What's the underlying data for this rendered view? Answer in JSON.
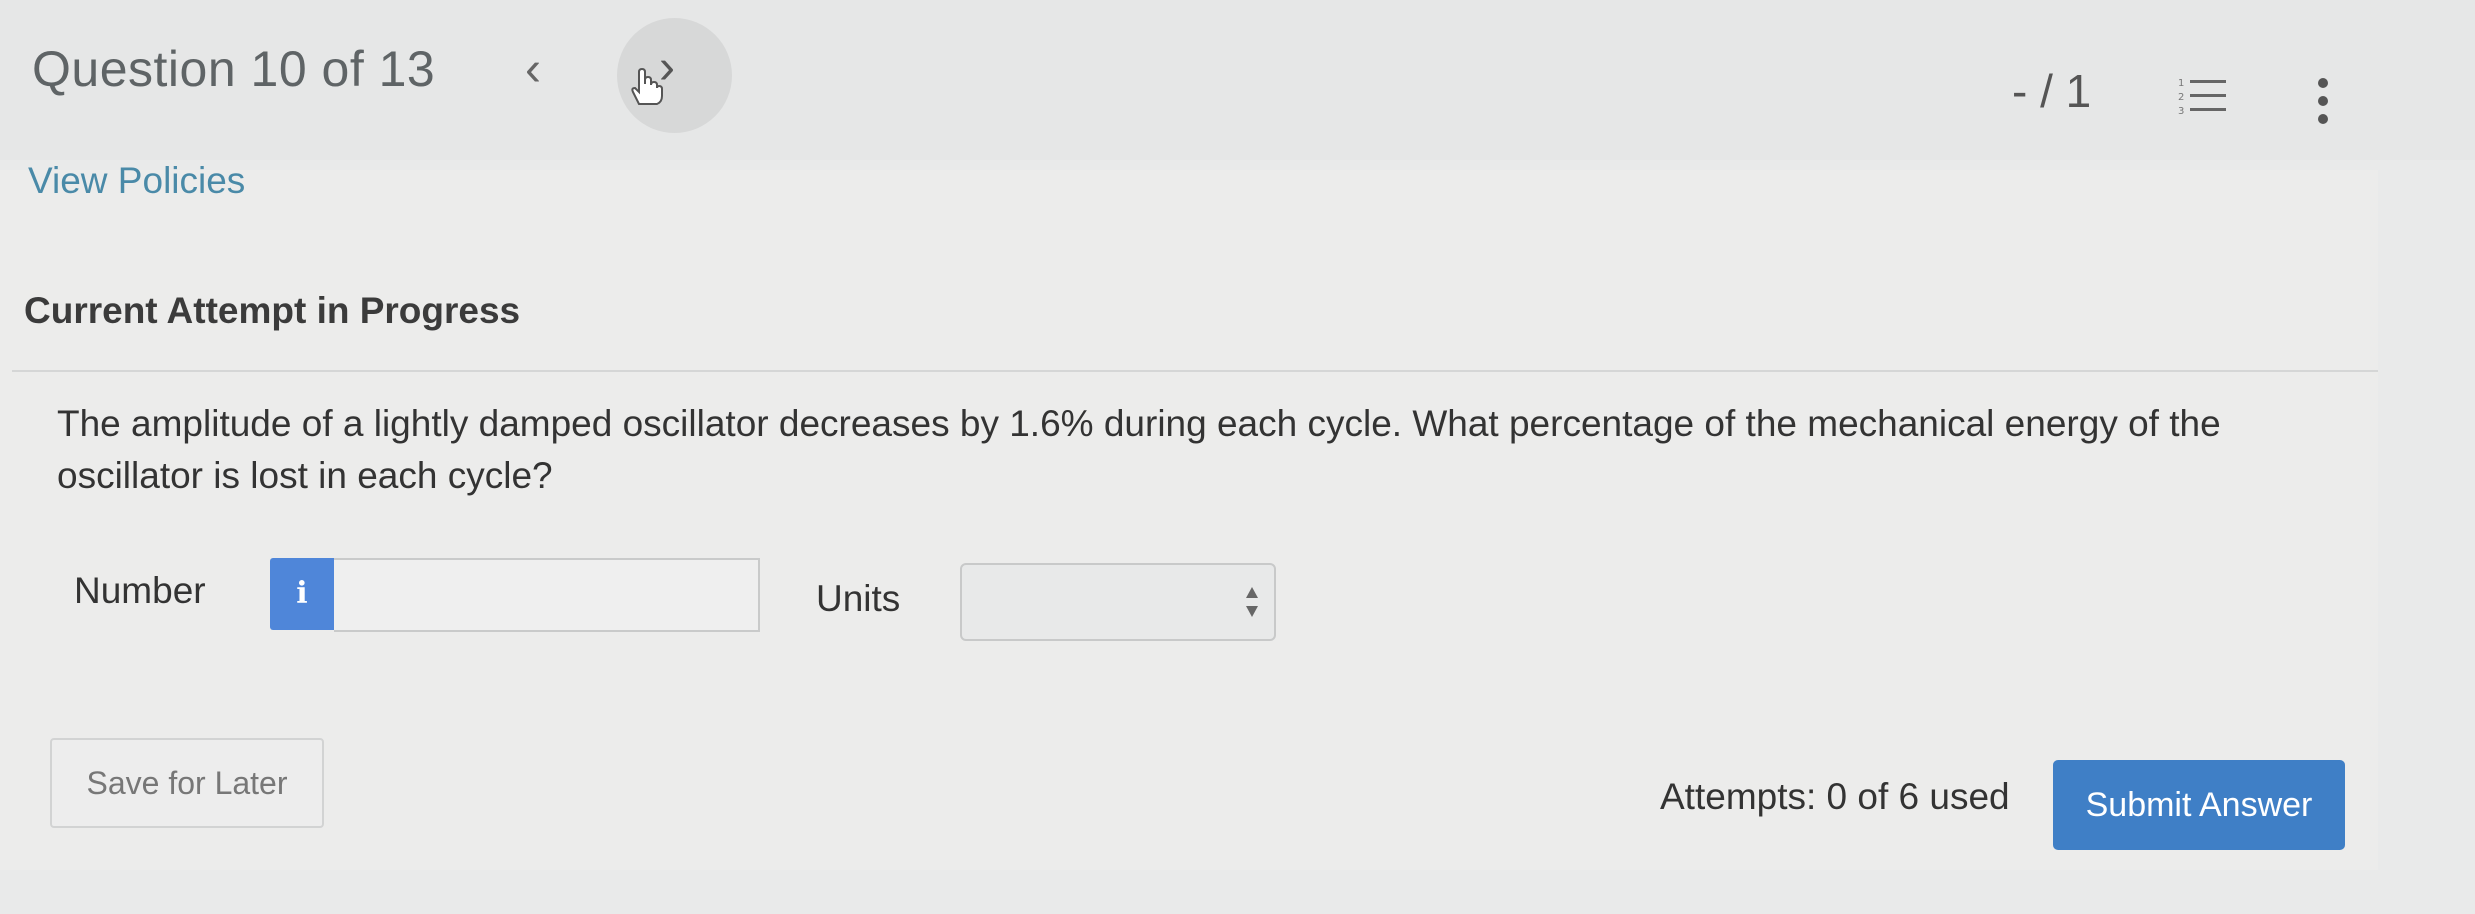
{
  "header": {
    "question_title": "Question 10 of 13",
    "prev_icon": "chevron-left-icon",
    "prev_glyph": "‹",
    "next_icon": "chevron-right-icon",
    "next_glyph": "›",
    "score": "- / 1",
    "list_icon": "numbered-list-icon",
    "menu_icon": "kebab-menu-icon"
  },
  "links": {
    "view_policies": "View Policies"
  },
  "attempt": {
    "heading": "Current Attempt in Progress"
  },
  "question": {
    "text": "The amplitude of a lightly damped oscillator decreases by 1.6% during each cycle. What percentage of the mechanical energy of the oscillator is lost in each cycle?"
  },
  "answer": {
    "number_label": "Number",
    "info_glyph": "i",
    "number_value": "",
    "units_label": "Units",
    "units_value": ""
  },
  "footer": {
    "save_label": "Save for Later",
    "attempts_text": "Attempts: 0 of 6 used",
    "submit_label": "Submit Answer"
  },
  "colors": {
    "accent": "#3f7fc6",
    "info_badge": "#4f86d9",
    "link": "#4a8aa8"
  }
}
